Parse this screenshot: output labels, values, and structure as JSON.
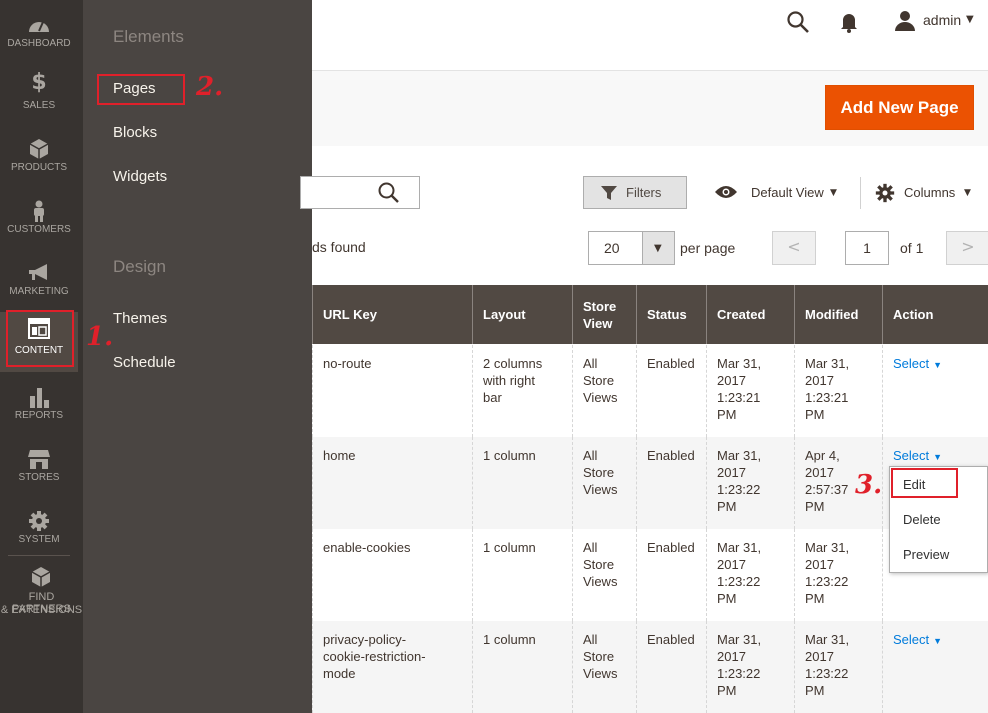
{
  "nav": {
    "items": [
      {
        "label": "DASHBOARD",
        "icon": "dashboard-icon"
      },
      {
        "label": "SALES",
        "icon": "dollar-icon"
      },
      {
        "label": "PRODUCTS",
        "icon": "cube-icon"
      },
      {
        "label": "CUSTOMERS",
        "icon": "person-icon"
      },
      {
        "label": "MARKETING",
        "icon": "megaphone-icon"
      },
      {
        "label": "CONTENT",
        "icon": "layout-icon"
      },
      {
        "label": "REPORTS",
        "icon": "bar-chart-icon"
      },
      {
        "label": "STORES",
        "icon": "storefront-icon"
      },
      {
        "label": "SYSTEM",
        "icon": "gear-icon"
      }
    ],
    "partners_line1": "FIND PARTNERS",
    "partners_line2": "& EXTENSIONS"
  },
  "submenu": {
    "elements_heading": "Elements",
    "pages": "Pages",
    "blocks": "Blocks",
    "widgets": "Widgets",
    "design_heading": "Design",
    "themes": "Themes",
    "schedule": "Schedule"
  },
  "header": {
    "user": "admin"
  },
  "toolbar": {
    "add_new_page": "Add New Page",
    "filters": "Filters",
    "default_view": "Default View",
    "columns": "Columns",
    "records_found": "ds found",
    "per_page_value": "20",
    "per_page_label": "per page",
    "page_current": "1",
    "page_total": "of 1"
  },
  "grid": {
    "headers": {
      "url_key": "URL Key",
      "layout": "Layout",
      "store_view_1": "Store",
      "store_view_2": "View",
      "status": "Status",
      "created": "Created",
      "modified": "Modified",
      "action": "Action"
    },
    "rows": [
      {
        "url_key": [
          "no-route"
        ],
        "layout": [
          "2 columns",
          "with right",
          "bar"
        ],
        "store": [
          "All",
          "Store",
          "Views"
        ],
        "status": "Enabled",
        "created": [
          "Mar 31,",
          "2017",
          "1:23:21",
          "PM"
        ],
        "modified": [
          "Mar 31,",
          "2017",
          "1:23:21",
          "PM"
        ],
        "action": "Select"
      },
      {
        "url_key": [
          "home"
        ],
        "layout": [
          "1 column"
        ],
        "store": [
          "All",
          "Store",
          "Views"
        ],
        "status": "Enabled",
        "created": [
          "Mar 31,",
          "2017",
          "1:23:22",
          "PM"
        ],
        "modified": [
          "Apr 4,",
          "2017",
          "2:57:37",
          "PM"
        ],
        "action": "Select"
      },
      {
        "url_key": [
          "enable-cookies"
        ],
        "layout": [
          "1 column"
        ],
        "store": [
          "All",
          "Store",
          "Views"
        ],
        "status": "Enabled",
        "created": [
          "Mar 31,",
          "2017",
          "1:23:22",
          "PM"
        ],
        "modified": [
          "Mar 31,",
          "2017",
          "1:23:22",
          "PM"
        ],
        "action": ""
      },
      {
        "url_key": [
          "privacy-policy-",
          "cookie-restriction-",
          "mode"
        ],
        "layout": [
          "1 column"
        ],
        "store": [
          "All",
          "Store",
          "Views"
        ],
        "status": "Enabled",
        "created": [
          "Mar 31,",
          "2017",
          "1:23:22",
          "PM"
        ],
        "modified": [
          "Mar 31,",
          "2017",
          "1:23:22",
          "PM"
        ],
        "action": "Select"
      }
    ]
  },
  "action_menu": {
    "edit": "Edit",
    "delete": "Delete",
    "preview": "Preview"
  },
  "annotations": {
    "step1": "1.",
    "step2": "2.",
    "step3": "3.",
    "color": "#e0202a"
  },
  "colors": {
    "accent": "#eb5202",
    "rail": "#373330",
    "flyout": "#4a4542",
    "grid_header": "#514943",
    "link": "#007bdb"
  }
}
